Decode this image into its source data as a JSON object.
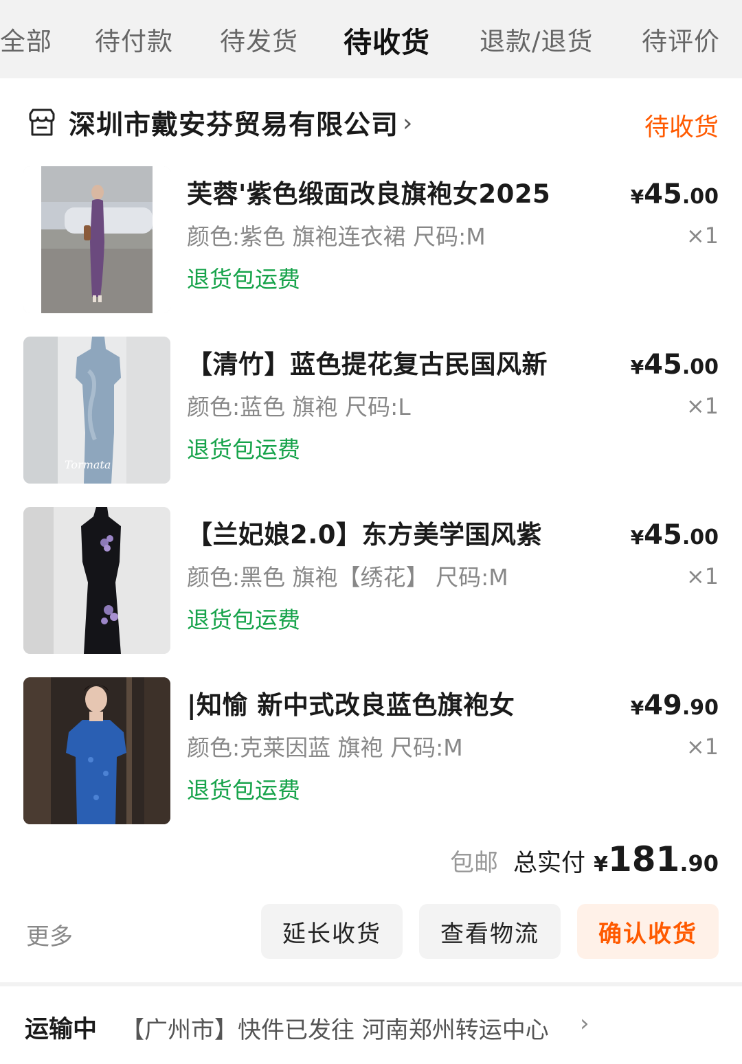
{
  "tabs": [
    {
      "label": "全部"
    },
    {
      "label": "待付款"
    },
    {
      "label": "待发货"
    },
    {
      "label": "待收货"
    },
    {
      "label": "退款/退货"
    },
    {
      "label": "待评价"
    }
  ],
  "order": {
    "shop_name": "深圳市戴安芬贸易有限公司",
    "status": "待收货",
    "items": [
      {
        "title": "芙蓉'紫色缎面改良旗袍女2025",
        "spec": "颜色:紫色 旗袍连衣裙 尺码:M",
        "badge": "退货包运费",
        "price_currency": "¥",
        "price_int": "45",
        "price_dec": ".00",
        "qty": "×1"
      },
      {
        "title": "【清竹】蓝色提花复古民国风新",
        "spec": "颜色:蓝色 旗袍 尺码:L",
        "badge": "退货包运费",
        "price_currency": "¥",
        "price_int": "45",
        "price_dec": ".00",
        "qty": "×1"
      },
      {
        "title": "【兰妃娘2.0】东方美学国风紫",
        "spec": "颜色:黑色 旗袍【绣花】 尺码:M",
        "badge": "退货包运费",
        "price_currency": "¥",
        "price_int": "45",
        "price_dec": ".00",
        "qty": "×1"
      },
      {
        "title": "|知愉 新中式改良蓝色旗袍女",
        "spec": "颜色:克莱因蓝 旗袍 尺码:M",
        "badge": "退货包运费",
        "price_currency": "¥",
        "price_int": "49",
        "price_dec": ".90",
        "qty": "×1"
      }
    ],
    "shipping": "包邮",
    "total_label": "总实付",
    "total_currency": "¥",
    "total_int": "181",
    "total_dec": ".90",
    "more_label": "更多",
    "buttons": {
      "extend": "延长收货",
      "track": "查看物流",
      "confirm": "确认收货"
    }
  },
  "logistics": {
    "status": "运输中",
    "message": "【广州市】快件已发往 河南郑州转运中心",
    "chevron": "›"
  },
  "colors": {
    "accent": "#ff5a00",
    "badge": "#16a34a"
  },
  "icons": {
    "shop": "store-icon",
    "chevron": "chevron-right-icon"
  }
}
